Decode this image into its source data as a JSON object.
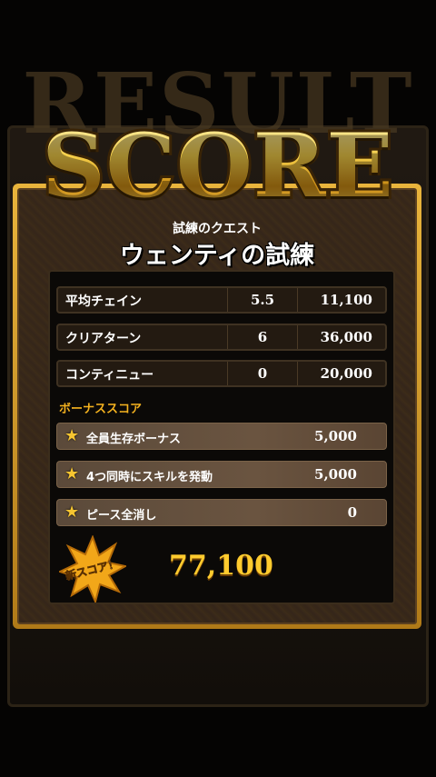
{
  "header": {
    "ghost_title": "RESULT",
    "title": "SCORE"
  },
  "quest": {
    "subtitle": "試練のクエスト",
    "name": "ウェンティの試練"
  },
  "stats": [
    {
      "label": "平均チェイン",
      "count": "5.5",
      "score": "11,100"
    },
    {
      "label": "クリアターン",
      "count": "6",
      "score": "36,000"
    },
    {
      "label": "コンティニュー",
      "count": "0",
      "score": "20,000"
    }
  ],
  "bonus": {
    "heading": "ボーナススコア",
    "items": [
      {
        "icon": "star-icon",
        "label": "全員生存ボーナス",
        "score": "5,000"
      },
      {
        "icon": "star-icon",
        "label": "4つ同時にスキルを発動",
        "score": "5,000"
      },
      {
        "icon": "star-icon",
        "label": "ピース全消し",
        "score": "0"
      }
    ]
  },
  "result": {
    "badge": "新スコア！",
    "total": "77,100"
  },
  "colors": {
    "gold": "#f5c93a",
    "bonus_heading": "#f4b21f",
    "total": "#ffcb2e"
  }
}
